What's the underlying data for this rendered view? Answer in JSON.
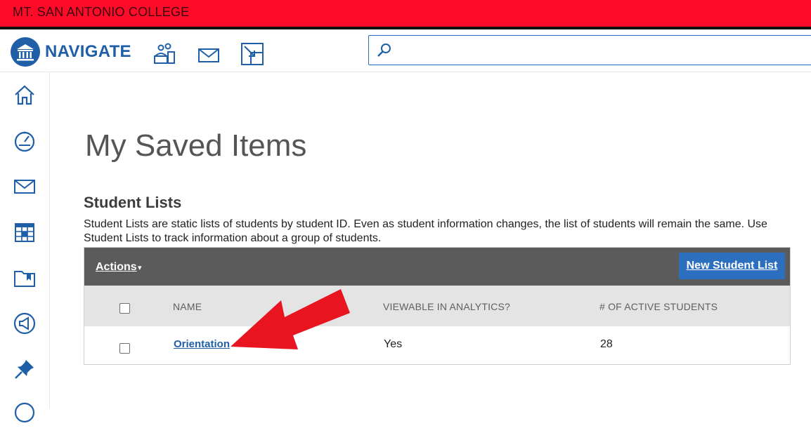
{
  "college": {
    "name": "MT. SAN ANTONIO COLLEGE"
  },
  "header": {
    "brand": "NAVIGATE",
    "search": {
      "placeholder": "",
      "value": ""
    },
    "icons": [
      "students-icon",
      "mail-icon",
      "resize-icon"
    ]
  },
  "sidebar": {
    "icons": [
      "home-icon",
      "dashboard-icon",
      "mail-icon",
      "calendar-icon",
      "folder-icon",
      "megaphone-icon",
      "pin-icon",
      "info-icon"
    ]
  },
  "page": {
    "title": "My Saved Items"
  },
  "student_lists": {
    "title": "Student Lists",
    "description": "Student Lists are static lists of students by student ID. Even as student information changes, the list of students will remain the same. Use Student Lists to track information about a group of students.",
    "toolbar": {
      "actions_label": "Actions",
      "caret": "▾",
      "new_button_label": "New Student List"
    },
    "columns": {
      "name": "NAME",
      "viewable": "VIEWABLE IN ANALYTICS?",
      "active": "# OF ACTIVE STUDENTS"
    },
    "rows": [
      {
        "name": "Orientation",
        "viewable": "Yes",
        "active": "28"
      }
    ]
  },
  "colors": {
    "college_bar": "#fe0b2a",
    "brand_blue": "#1f5fa8",
    "toolbar": "#5b5b5b",
    "button": "#2d6fbf",
    "arrow": "#e8141f"
  }
}
